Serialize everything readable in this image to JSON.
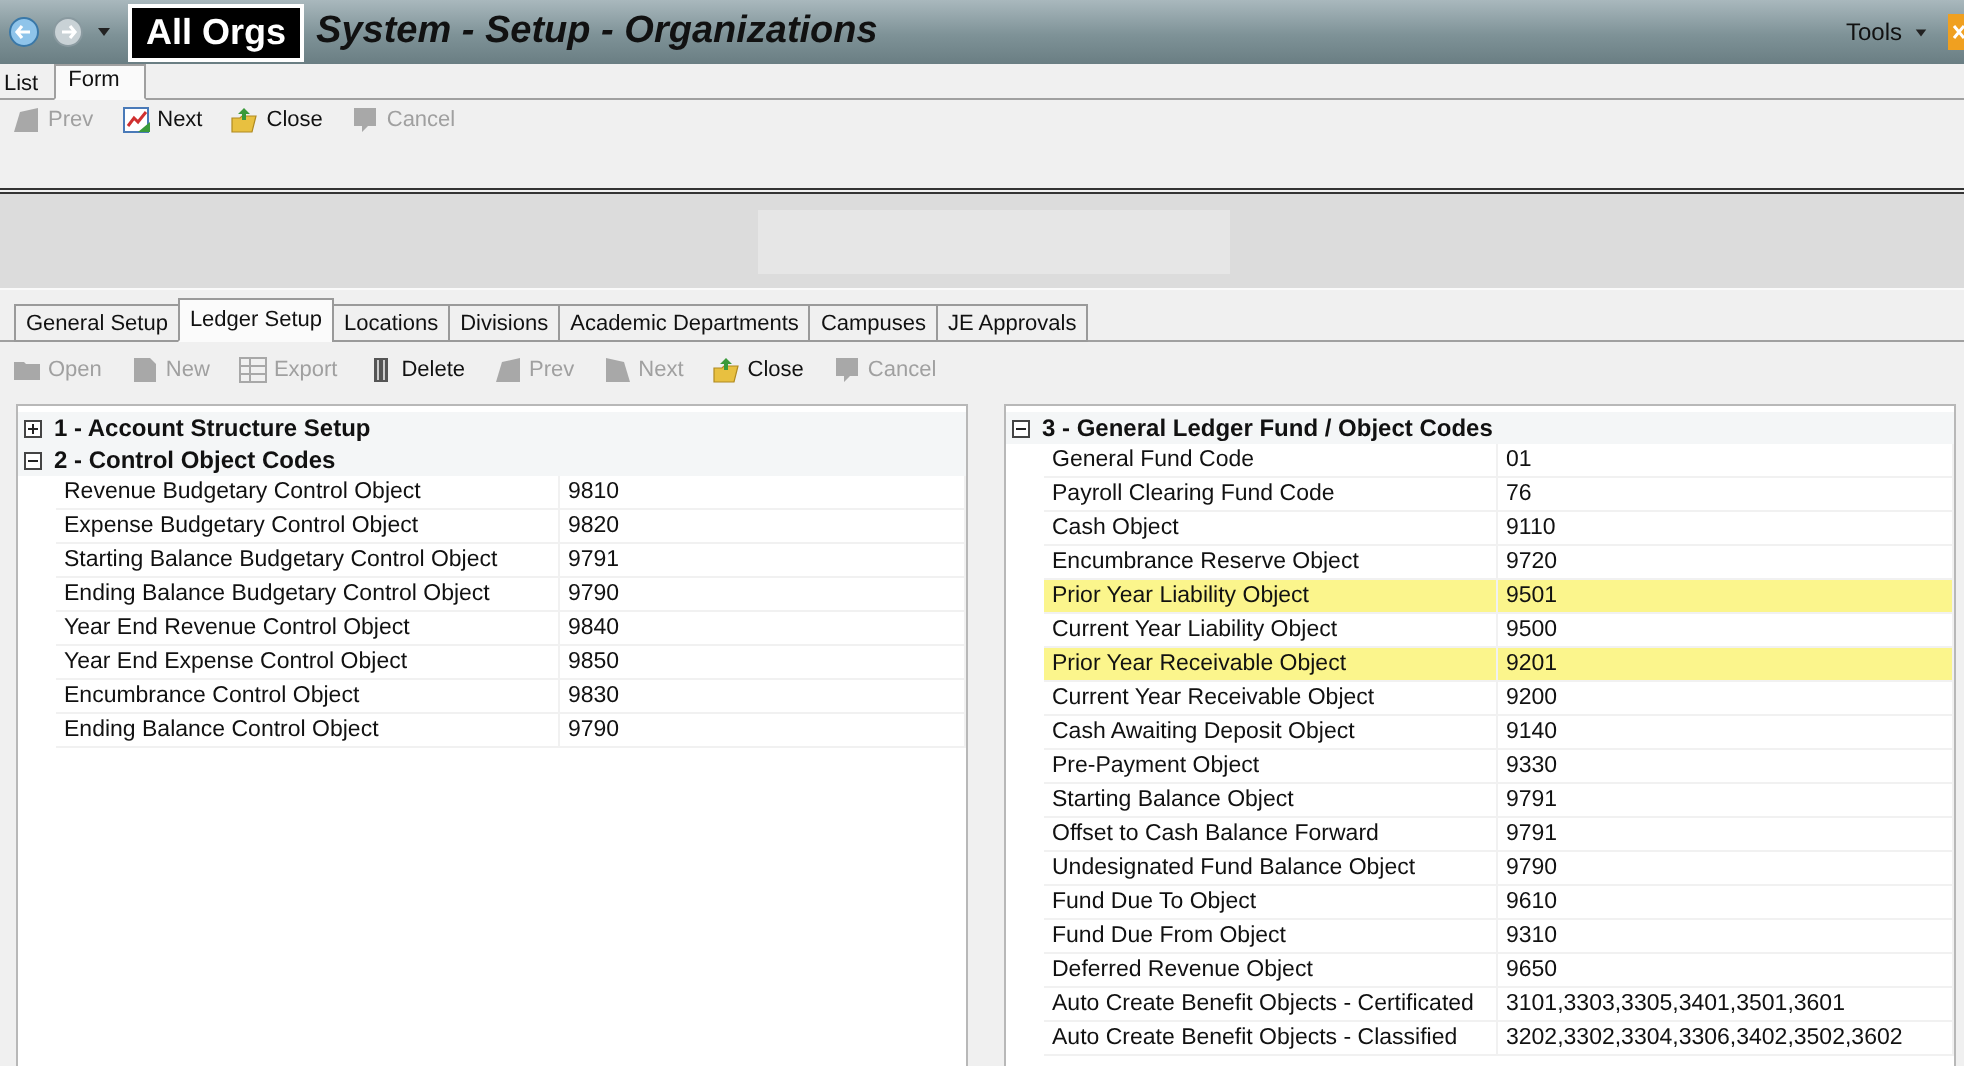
{
  "title_bar": {
    "org": "All Orgs",
    "title": "System - Setup - Organizations",
    "tools": "Tools"
  },
  "view_tabs": [
    {
      "label": "List",
      "selected": false
    },
    {
      "label": "Form",
      "selected": true
    }
  ],
  "form_toolbar": [
    {
      "kind": "prev",
      "label": "Prev",
      "disabled": true
    },
    {
      "kind": "next",
      "label": "Next",
      "disabled": false
    },
    {
      "kind": "close",
      "label": "Close",
      "disabled": false
    },
    {
      "kind": "cancel",
      "label": "Cancel",
      "disabled": true
    }
  ],
  "section_tabs": [
    {
      "label": "General Setup",
      "selected": false
    },
    {
      "label": "Ledger Setup",
      "selected": true
    },
    {
      "label": "Locations",
      "selected": false
    },
    {
      "label": "Divisions",
      "selected": false
    },
    {
      "label": "Academic Departments",
      "selected": false
    },
    {
      "label": "Campuses",
      "selected": false
    },
    {
      "label": "JE Approvals",
      "selected": false
    }
  ],
  "ledger_toolbar": [
    {
      "kind": "open",
      "label": "Open",
      "disabled": true
    },
    {
      "kind": "new",
      "label": "New",
      "disabled": true
    },
    {
      "kind": "export",
      "label": "Export",
      "disabled": true
    },
    {
      "kind": "delete",
      "label": "Delete",
      "disabled": false
    },
    {
      "kind": "prev",
      "label": "Prev",
      "disabled": true
    },
    {
      "kind": "next",
      "label": "Next",
      "disabled": true
    },
    {
      "kind": "close",
      "label": "Close",
      "disabled": false
    },
    {
      "kind": "cancel",
      "label": "Cancel",
      "disabled": true
    }
  ],
  "left_panel": {
    "groups": [
      {
        "title": "1 - Account Structure Setup",
        "expanded": false
      },
      {
        "title": "2 - Control Object Codes",
        "expanded": true,
        "rows": [
          {
            "label": "Revenue Budgetary Control Object",
            "value": "9810",
            "highlighted": false
          },
          {
            "label": "Expense Budgetary Control Object",
            "value": "9820",
            "highlighted": false
          },
          {
            "label": "Starting Balance Budgetary Control Object",
            "value": "9791",
            "highlighted": false
          },
          {
            "label": "Ending Balance Budgetary Control Object",
            "value": "9790",
            "highlighted": false
          },
          {
            "label": "Year End Revenue Control Object",
            "value": "9840",
            "highlighted": false
          },
          {
            "label": "Year End Expense Control Object",
            "value": "9850",
            "highlighted": false
          },
          {
            "label": "Encumbrance Control Object",
            "value": "9830",
            "highlighted": false
          },
          {
            "label": "Ending Balance Control Object",
            "value": "9790",
            "highlighted": false
          }
        ]
      }
    ]
  },
  "right_panel": {
    "groups": [
      {
        "title": "3 - General Ledger Fund / Object Codes",
        "expanded": true,
        "rows": [
          {
            "label": "General Fund Code",
            "value": "01",
            "highlighted": false
          },
          {
            "label": "Payroll Clearing Fund Code",
            "value": "76",
            "highlighted": false
          },
          {
            "label": "Cash Object",
            "value": "9110",
            "highlighted": false
          },
          {
            "label": "Encumbrance Reserve Object",
            "value": "9720",
            "highlighted": false
          },
          {
            "label": "Prior Year Liability Object",
            "value": "9501",
            "highlighted": true
          },
          {
            "label": "Current Year Liability Object",
            "value": "9500",
            "highlighted": false
          },
          {
            "label": "Prior Year Receivable Object",
            "value": "9201",
            "highlighted": true
          },
          {
            "label": "Current Year Receivable Object",
            "value": "9200",
            "highlighted": false
          },
          {
            "label": "Cash Awaiting Deposit Object",
            "value": "9140",
            "highlighted": false
          },
          {
            "label": "Pre-Payment Object",
            "value": "9330",
            "highlighted": false
          },
          {
            "label": "Starting Balance Object",
            "value": "9791",
            "highlighted": false
          },
          {
            "label": "Offset to Cash Balance Forward",
            "value": "9791",
            "highlighted": false
          },
          {
            "label": "Undesignated Fund Balance Object",
            "value": "9790",
            "highlighted": false
          },
          {
            "label": "Fund Due To Object",
            "value": "9610",
            "highlighted": false
          },
          {
            "label": "Fund Due From Object",
            "value": "9310",
            "highlighted": false
          },
          {
            "label": "Deferred Revenue Object",
            "value": "9650",
            "highlighted": false
          },
          {
            "label": "Auto Create Benefit Objects - Certificated",
            "value": "3101,3303,3305,3401,3501,3601",
            "highlighted": false
          },
          {
            "label": "Auto Create Benefit Objects - Classified",
            "value": "3202,3302,3304,3306,3402,3502,3602",
            "highlighted": false
          }
        ]
      }
    ]
  }
}
